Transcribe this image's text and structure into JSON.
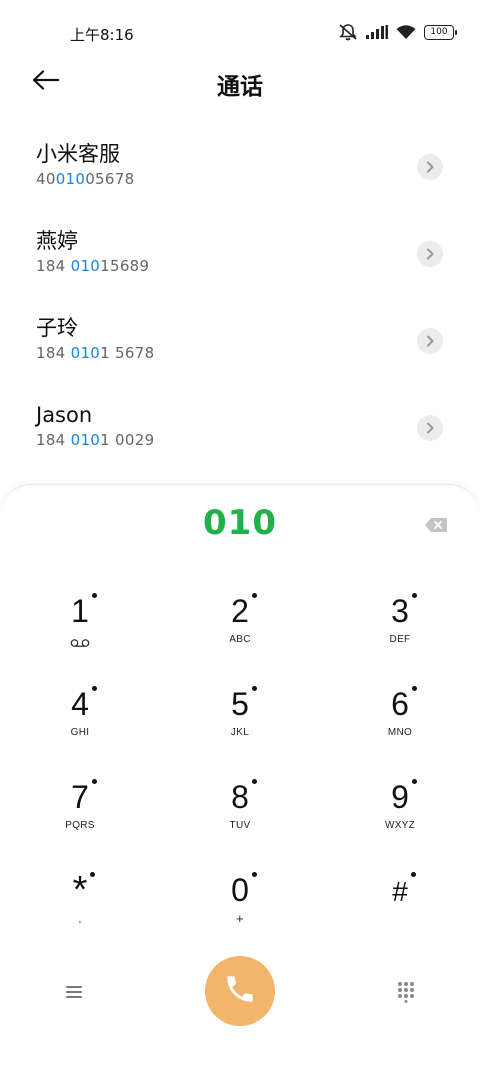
{
  "status_bar": {
    "time": "上午8:16",
    "battery": "100",
    "icons": [
      "mute-bell-icon",
      "signal-icon",
      "wifi-icon",
      "battery-icon"
    ]
  },
  "header": {
    "title": "通话",
    "back_icon": "arrow-left-icon"
  },
  "contacts": [
    {
      "name": "小米客服",
      "number_pre": "40",
      "number_match": "010",
      "number_post": "05678"
    },
    {
      "name": "燕婷",
      "number_pre": "184 ",
      "number_match": "010",
      "number_post": "15689"
    },
    {
      "name": "子玲",
      "number_pre": "184 ",
      "number_match": "010",
      "number_post": "1 5678"
    },
    {
      "name": "Jason",
      "number_pre": "184 ",
      "number_match": "010",
      "number_post": "1 0029"
    }
  ],
  "dialpad": {
    "dialed_number": "010",
    "keys": [
      {
        "digit": "1",
        "letters": ""
      },
      {
        "digit": "2",
        "letters": "ABC"
      },
      {
        "digit": "3",
        "letters": "DEF"
      },
      {
        "digit": "4",
        "letters": "GHI"
      },
      {
        "digit": "5",
        "letters": "JKL"
      },
      {
        "digit": "6",
        "letters": "MNO"
      },
      {
        "digit": "7",
        "letters": "PQRS"
      },
      {
        "digit": "8",
        "letters": "TUV"
      },
      {
        "digit": "9",
        "letters": "WXYZ"
      },
      {
        "digit": "*",
        "letters": ","
      },
      {
        "digit": "0",
        "letters": "+"
      },
      {
        "digit": "#",
        "letters": ""
      }
    ]
  },
  "colors": {
    "accent_green": "#21b14b",
    "match_blue": "#1a84d6",
    "call_button": "#f2b56b"
  }
}
